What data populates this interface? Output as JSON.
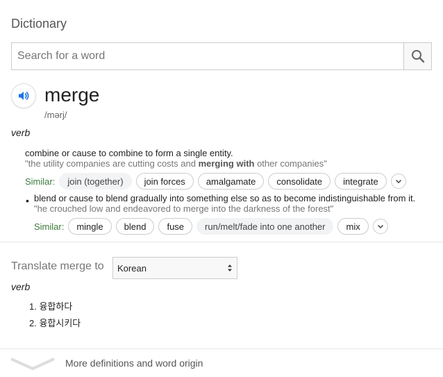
{
  "header": {
    "title": "Dictionary"
  },
  "search": {
    "placeholder": "Search for a word"
  },
  "entry": {
    "word": "merge",
    "phonetic": "/mərj/",
    "part_of_speech": "verb",
    "senses": [
      {
        "definition": "combine or cause to combine to form a single entity.",
        "example_pre": "\"the utility companies are cutting costs and ",
        "example_bold": "merging with",
        "example_post": " other companies\"",
        "similar_label": "Similar:",
        "similar": [
          "join (together)",
          "join forces",
          "amalgamate",
          "consolidate",
          "integrate"
        ]
      },
      {
        "bullet": "•",
        "definition": "blend or cause to blend gradually into something else so as to become indistinguishable from it.",
        "example": "\"he crouched low and endeavored to merge into the darkness of the forest\"",
        "similar_label": "Similar:",
        "similar": [
          "mingle",
          "blend",
          "fuse",
          "run/melt/fade into one another",
          "mix"
        ]
      }
    ]
  },
  "translate": {
    "label": "Translate merge to",
    "language": "Korean",
    "part_of_speech": "verb",
    "items": [
      "1. 융합하다",
      "2. 융합시키다"
    ]
  },
  "footer": {
    "more_label": "More definitions and word origin"
  },
  "colors": {
    "similar_label": "#3c7b3d",
    "speaker_icon": "#1a73e8"
  }
}
